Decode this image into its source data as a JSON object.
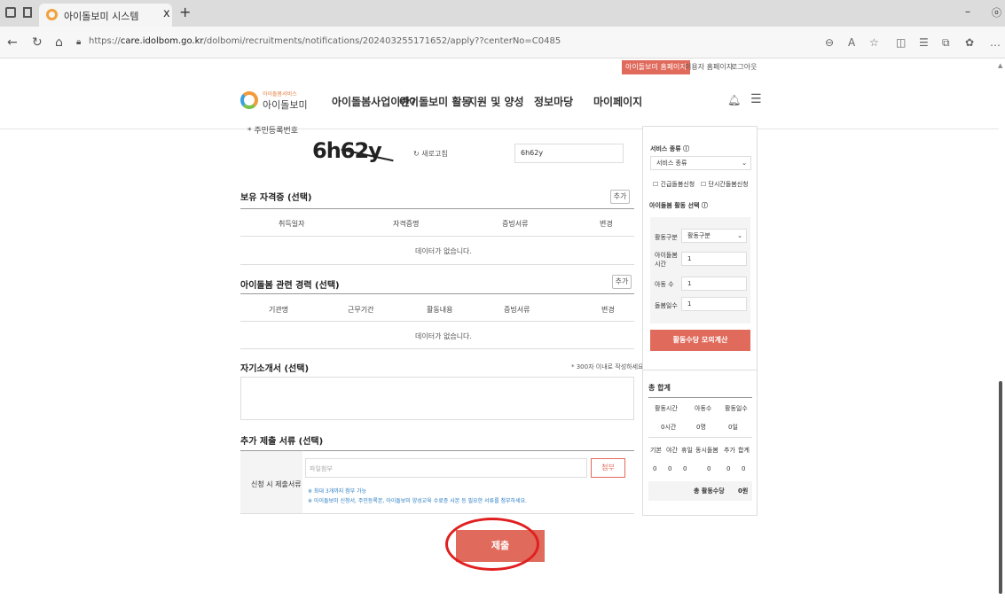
{
  "browser": {
    "tab_title": "아이돌보미 시스템",
    "tab_close": "x",
    "new_tab": "+",
    "url_prefix": "https://",
    "url_domain": "care.idolbom.go.kr",
    "url_path": "/dolbomi/recruitments/notifications/202403255171652/apply??centerNo=C0485",
    "minimize": "–",
    "more": "…"
  },
  "utility_nav": {
    "items": [
      "아이돌보미 홈페이지",
      "이용자 홈페이지",
      "로그아웃"
    ]
  },
  "header": {
    "logo_small": "아이돌봄서비스",
    "logo_text": "아이돌보미",
    "menu": [
      "아이돌봄사업이란?",
      "아이돌보미 활동",
      "지원 및 양성",
      "정보마당",
      "마이페이지"
    ]
  },
  "form": {
    "id_label": "* 주민등록번호",
    "captcha_text": "6h62y",
    "refresh_label": "↻ 새로고침",
    "captcha_input": "6h62y",
    "license_section": "보유 자격증 (선택)",
    "add_label": "추가",
    "license_columns": [
      "취득일자",
      "자격증명",
      "증빙서류",
      "변경"
    ],
    "no_data": "데이터가 없습니다.",
    "career_section": "아이돌봄 관련 경력 (선택)",
    "career_columns": [
      "기관명",
      "근무기간",
      "활동내용",
      "증빙서류",
      "변경"
    ],
    "intro_section": "자기소개서 (선택)",
    "intro_hint": "* 300자 이내로 작성하세요.",
    "docs_section": "추가 제출 서류 (선택)",
    "docs_label": "신청 시 제출서류",
    "file_placeholder": "파일첨부",
    "attach_label": "첨부",
    "note1": "※ 최대 3개까지 첨부 가능",
    "note2": "※ 아이돌보미 신청서, 주민등록본, 아이돌보미 양성교육 수료증 사본 등 필요한 서류를 첨부하세요.",
    "submit_label": "제출"
  },
  "sidebar": {
    "service_type_label": "서비스 종류 ⓘ",
    "service_type_value": "서비스 종류",
    "checkbox1": "긴급돌봄신청",
    "checkbox2": "단시간돌봄신청",
    "activity_title": "아이돌봄 활동 선택 ⓘ",
    "activity_type_label": "활동구분",
    "activity_type_value": "활동구분",
    "time_label": "아이돌봄 시간",
    "time_value": "1",
    "kids_label": "아동 수",
    "kids_value": "1",
    "days_label": "돌봄일수",
    "days_value": "1",
    "calc_button": "활동수당 모의계산",
    "total_title": "총 합계",
    "total_headers": [
      "활동시간",
      "아동수",
      "활동일수"
    ],
    "total_values": [
      "0시간",
      "0명",
      "0일"
    ],
    "pay_headers": [
      "기본",
      "야간",
      "휴일",
      "동시돌봄",
      "추가",
      "합계"
    ],
    "pay_values": [
      "0",
      "0",
      "0",
      "0",
      "0",
      "0"
    ],
    "pay_total_label": "총 활동수당",
    "pay_total_value": "0원"
  },
  "colors": {
    "accent": "#e06a5b",
    "annotation": "#e02020"
  }
}
